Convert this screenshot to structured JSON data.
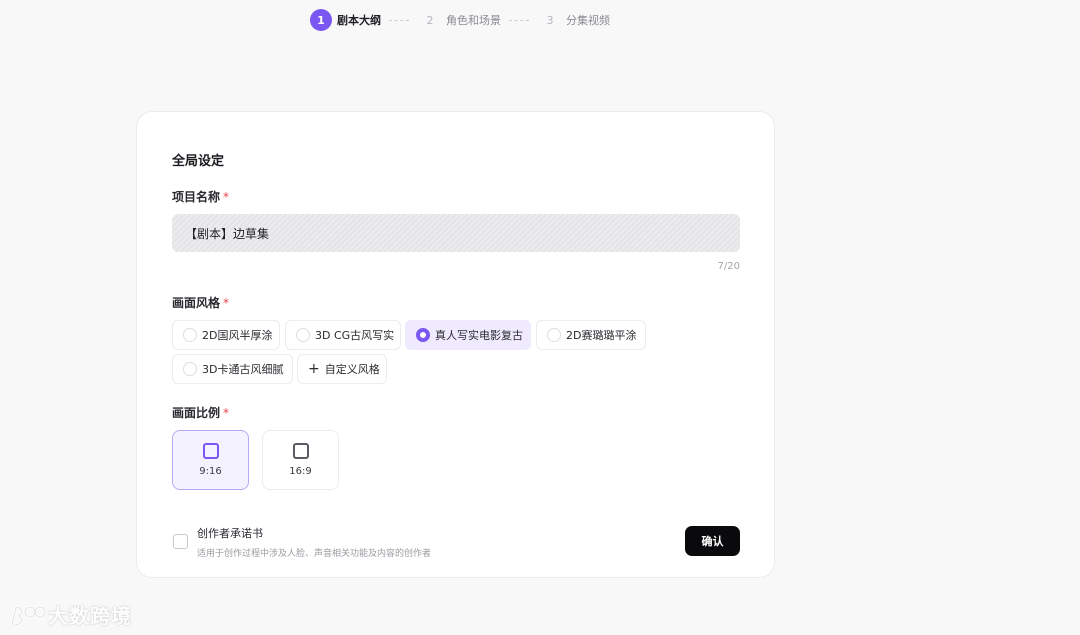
{
  "stepper": {
    "steps": [
      {
        "num": "1",
        "label": "剧本大纲"
      },
      {
        "num": "2",
        "label": "角色和场景"
      },
      {
        "num": "3",
        "label": "分集视频"
      }
    ]
  },
  "form": {
    "title": "全局设定",
    "project_name": {
      "label": "项目名称",
      "required": "*",
      "value": "【剧本】边草集",
      "counter": "7/20"
    },
    "style": {
      "label": "画面风格",
      "required": "*",
      "options": [
        "2D国风半厚涂",
        "3D CG古风写实",
        "真人写实电影复古",
        "2D赛璐璐平涂",
        "3D卡通古风细腻"
      ],
      "selected": "真人写实电影复古",
      "custom_label": "自定义风格"
    },
    "ratio": {
      "label": "画面比例",
      "required": "*",
      "options": [
        "9:16",
        "16:9"
      ],
      "selected": "9:16"
    },
    "promise": {
      "title": "创作者承诺书",
      "description": "适用于创作过程中涉及人脸、声音相关功能及内容的创作者"
    },
    "confirm_label": "确认"
  },
  "watermark": "大数跨境",
  "colors": {
    "accent": "#7a57f0",
    "required": "#e5484d",
    "button": "#0a0a0c"
  }
}
